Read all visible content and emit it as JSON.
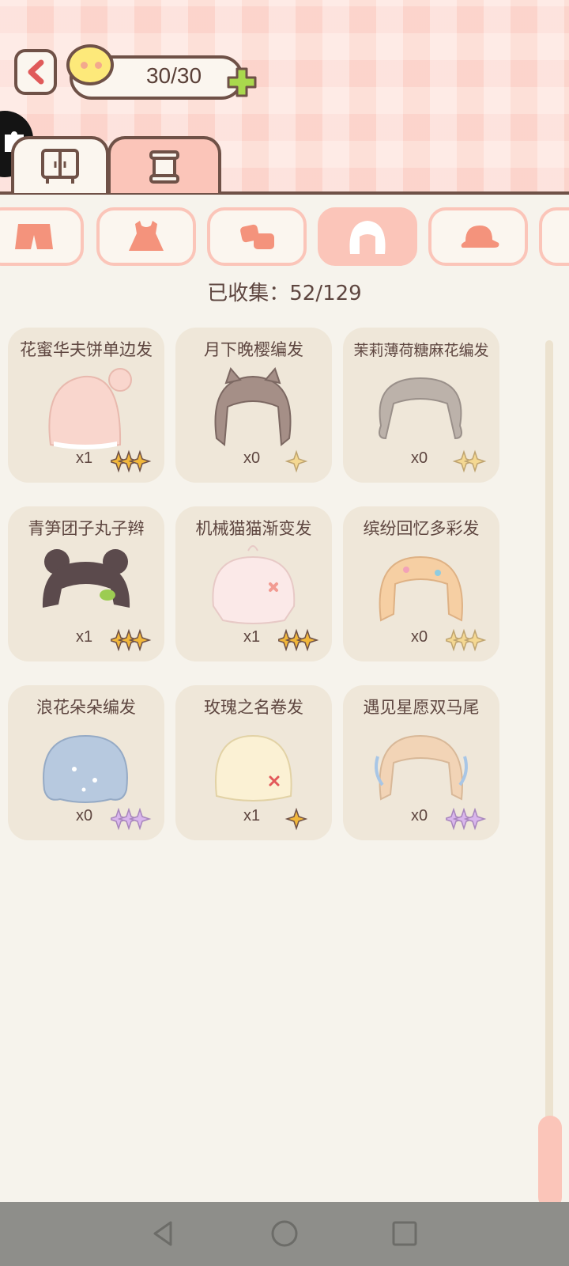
{
  "header": {
    "energy": "30/30"
  },
  "collection": {
    "label": "已收集：52/129"
  },
  "items": [
    {
      "name": "花蜜华夫饼单边发",
      "count": "x1",
      "star_color": "#f1b73b",
      "hair_color": "#f9d6cd",
      "rarity": 3
    },
    {
      "name": "月下晚樱编发",
      "count": "x0",
      "star_color": "#f4d892",
      "hair_color": "#a58f87",
      "rarity": 1
    },
    {
      "name": "茉莉薄荷糖麻花编发",
      "count": "x0",
      "star_color": "#f4d892",
      "hair_color": "#bcb2aa",
      "rarity": 2
    },
    {
      "name": "青笋团子丸子辫",
      "count": "x1",
      "star_color": "#f1b73b",
      "hair_color": "#5b4a4c",
      "rarity": 3
    },
    {
      "name": "机械猫猫渐变发",
      "count": "x1",
      "star_color": "#f1b73b",
      "hair_color": "#fbe9e8",
      "rarity": 3
    },
    {
      "name": "缤纷回忆多彩发",
      "count": "x0",
      "star_color": "#f4d892",
      "hair_color": "#f6cfa3",
      "rarity": 3
    },
    {
      "name": "浪花朵朵编发",
      "count": "x0",
      "star_color": "#d9b6ec",
      "hair_color": "#b7c9df",
      "rarity": 3
    },
    {
      "name": "玫瑰之名卷发",
      "count": "x1",
      "star_color": "#f1b73b",
      "hair_color": "#fbf1d4",
      "rarity": 1
    },
    {
      "name": "遇见星愿双马尾",
      "count": "x0",
      "star_color": "#d9b6ec",
      "hair_color": "#f2d4b6",
      "rarity": 3
    }
  ],
  "categories": [
    "pants-icon",
    "dress-icon",
    "shoes-icon",
    "hair-icon",
    "hat-icon"
  ],
  "colors": {
    "accent": "#fbc5b9",
    "outline": "#6f5147",
    "card": "#efe7d9"
  }
}
